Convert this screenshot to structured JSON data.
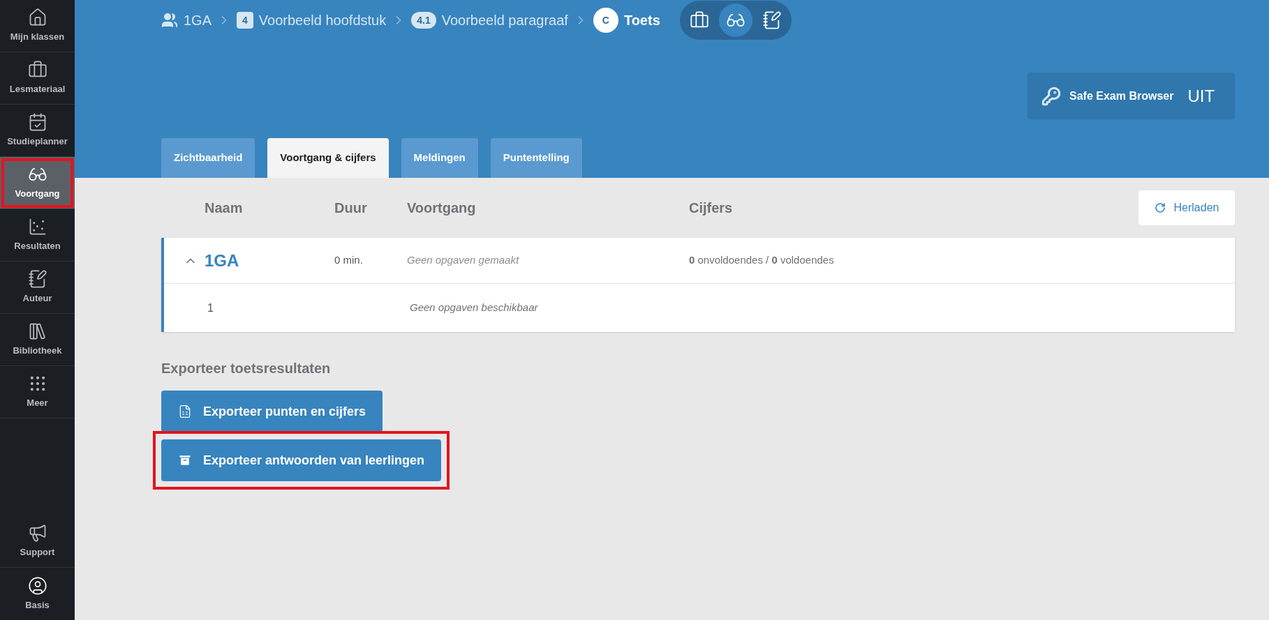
{
  "sidebar": {
    "items": [
      {
        "label": "Mijn klassen",
        "selected": false,
        "highlighted": false
      },
      {
        "label": "Lesmateriaal",
        "selected": false,
        "highlighted": false
      },
      {
        "label": "Studieplanner",
        "selected": false,
        "highlighted": false
      },
      {
        "label": "Voortgang",
        "selected": true,
        "highlighted": true
      },
      {
        "label": "Resultaten",
        "selected": false,
        "highlighted": false
      },
      {
        "label": "Auteur",
        "selected": false,
        "highlighted": false
      },
      {
        "label": "Bibliotheek",
        "selected": false,
        "highlighted": false
      },
      {
        "label": "Meer",
        "selected": false,
        "highlighted": false
      }
    ],
    "bottom_items": [
      {
        "label": "Support"
      },
      {
        "label": "Basis"
      }
    ]
  },
  "breadcrumb": [
    {
      "kind": "group",
      "label": "1GA"
    },
    {
      "kind": "badge",
      "badge": "4",
      "label": "Voorbeeld hoofdstuk"
    },
    {
      "kind": "pill",
      "badge": "4.1",
      "label": "Voorbeeld paragraaf"
    },
    {
      "kind": "circle",
      "badge": "C",
      "label": "Toets"
    }
  ],
  "view_switch": [
    {
      "selected": false
    },
    {
      "selected": true
    },
    {
      "selected": false
    }
  ],
  "seb_button": {
    "label": "Safe Exam Browser",
    "state": "UIT"
  },
  "tabs": [
    {
      "label": "Zichtbaarheid",
      "selected": false
    },
    {
      "label": "Voortgang & cijfers",
      "selected": true
    },
    {
      "label": "Meldingen",
      "selected": false
    },
    {
      "label": "Puntentelling",
      "selected": false
    }
  ],
  "reload_button": {
    "label": "Herladen"
  },
  "table": {
    "columns": [
      "Naam",
      "Duur",
      "Voortgang",
      "Cijfers"
    ],
    "group": {
      "name": "1GA",
      "expanded": true,
      "duration": "0 min.",
      "progress": "Geen opgaven gemaakt",
      "grades": "**0** onvoldoendes / **0** voldoendes"
    },
    "rows": [
      {
        "name": "1",
        "progress": "Geen opgaven beschikbaar"
      }
    ]
  },
  "export": {
    "title": "Exporteer toetsresultaten",
    "buttons": [
      {
        "kind": "spreadsheet",
        "label": "Exporteer punten en cijfers",
        "highlighted": false
      },
      {
        "kind": "archive",
        "label": "Exporteer antwoorden van leerlingen",
        "highlighted": true
      }
    ]
  }
}
